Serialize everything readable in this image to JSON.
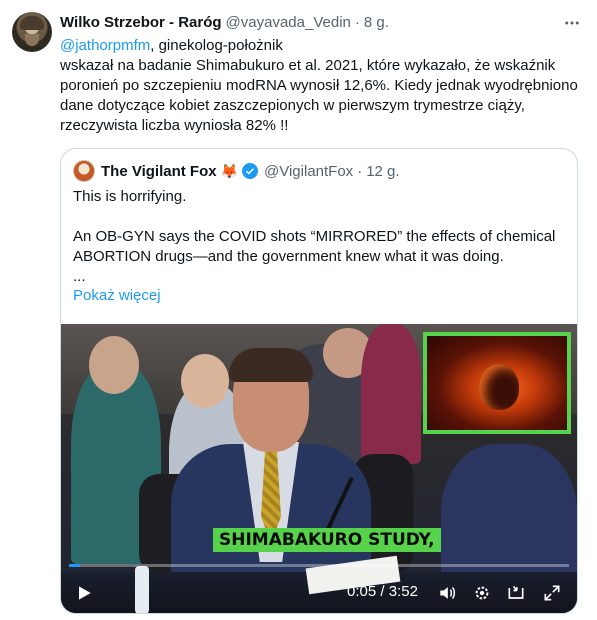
{
  "tweet": {
    "author_name": "Wilko Strzebor - Raróg",
    "author_handle": "@vayavada_Vedin",
    "separator": "·",
    "time": "8 g.",
    "more_icon": "more-horizontal-icon",
    "mention": "@jathorpmfm",
    "mention_suffix": ", ginekolog-położnik",
    "text": "wskazał na badanie Shimabukuro et al. 2021, które wykazało, że wskaźnik poronień po szczepieniu modRNA wynosił 12,6%. Kiedy jednak wyodrębniono dane dotyczące kobiet zaszczepionych w pierwszym trymestrze ciąży, rzeczywista liczba wyniosła 82% !!"
  },
  "quote": {
    "author_name": "The Vigilant Fox",
    "fox_emoji": "🦊",
    "verified_icon": "verified-badge-icon",
    "author_handle": "@VigilantFox",
    "separator": "·",
    "time": "12 g.",
    "line1": "This is horrifying.",
    "line2": "An OB-GYN says the COVID shots “MIRRORED” the effects of chemical ABORTION drugs—and the government knew what it was doing.",
    "ellipsis": "...",
    "show_more": "Pokaż więcej"
  },
  "video": {
    "caption": "SHIMABAKURO STUDY,",
    "current_time": "0:05",
    "duration": "3:52",
    "time_separator": " / ",
    "progress_fraction": 0.022,
    "accent_color": "#1d9bf0",
    "caption_bg_color": "#56d34a",
    "controls": {
      "play_icon": "play-icon",
      "volume_icon": "volume-icon",
      "settings_icon": "gear-icon",
      "pip_icon": "picture-in-picture-icon",
      "fullscreen_icon": "fullscreen-icon"
    }
  }
}
